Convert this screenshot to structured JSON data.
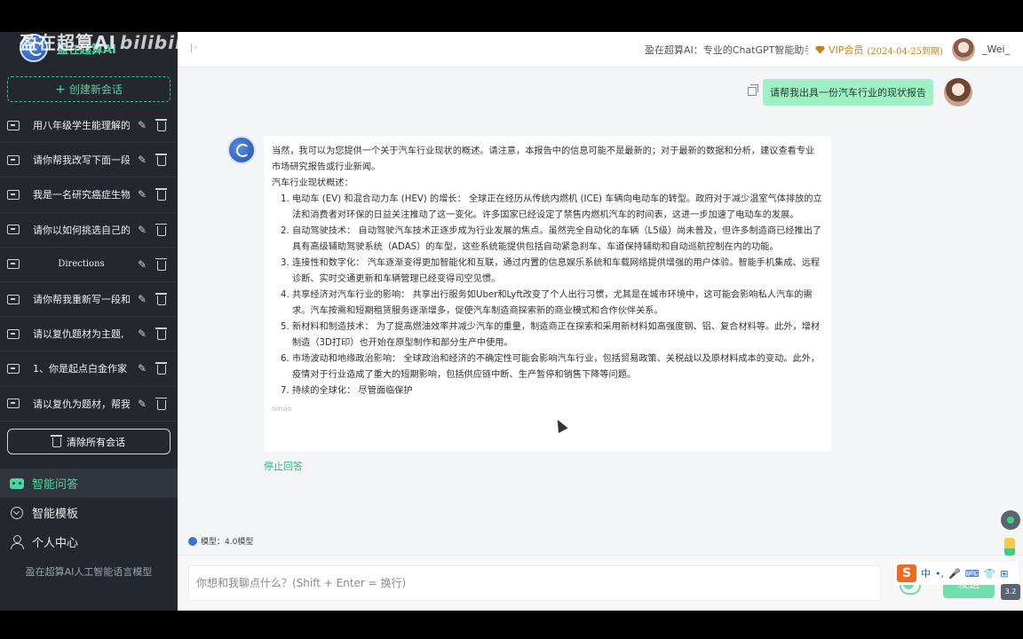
{
  "sidebar": {
    "brand": "盈在超算AI",
    "new_chat_label": "创建新会话",
    "conversations": [
      {
        "label": "用八年级学生能理解的"
      },
      {
        "label": "请你帮我改写下面一段"
      },
      {
        "label": "我是一名研究癌症生物"
      },
      {
        "label": "请你以如何挑选自己的"
      },
      {
        "label": "Directions"
      },
      {
        "label": "请你帮我重新写一段和"
      },
      {
        "label": "请以复仇题材为主题,"
      },
      {
        "label": "1、你是起点白金作家"
      },
      {
        "label": "请以复仇为题材，帮我"
      }
    ],
    "clear_all_label": "清除所有会话",
    "menu": [
      {
        "label": "智能问答",
        "icon": "robot-icon"
      },
      {
        "label": "智能模板",
        "icon": "template-icon"
      },
      {
        "label": "个人中心",
        "icon": "user-icon"
      }
    ],
    "footer": "盈在超算AI人工智能语言模型"
  },
  "header": {
    "collapse": "|◦",
    "title": "盈在超算AI：专业的ChatGPT智能助手",
    "vip_label": "VIP会员",
    "vip_expiry": "(2024-04-25到期)",
    "username": "_Wei_"
  },
  "chat": {
    "user_message": "请帮我出具一份汽车行业的现状报告",
    "bot_intro": "当然，我可以为您提供一个关于汽车行业现状的概述。请注意，本报告中的信息可能不是最新的；对于最新的数据和分析，建议查看专业市场研究报告或行业新闻。",
    "bot_heading": "汽车行业现状概述：",
    "bot_points": [
      {
        "num": "1.",
        "text": "电动车 (EV) 和混合动力车 (HEV) 的增长： 全球正在经历从传统内燃机 (ICE) 车辆向电动车的转型。政府对于减少温室气体排放的立法和消费者对环保的日益关注推动了这一变化。许多国家已经设定了禁售内燃机汽车的时间表，这进一步加速了电动车的发展。"
      },
      {
        "num": "2.",
        "text": "自动驾驶技术： 自动驾驶汽车技术正逐步成为行业发展的焦点。虽然完全自动化的车辆（L5级）尚未普及，但许多制造商已经推出了具有高级辅助驾驶系统（ADAS）的车型，这些系统能提供包括自动紧急刹车、车道保持辅助和自动巡航控制在内的功能。"
      },
      {
        "num": "3.",
        "text": "连接性和数字化： 汽车逐渐变得更加智能化和互联，通过内置的信息娱乐系统和车载网络提供增强的用户体验。智能手机集成、远程诊断、实时交通更新和车辆管理已经变得司空见惯。"
      },
      {
        "num": "4.",
        "text": "共享经济对汽车行业的影响： 共享出行服务如Uber和Lyft改变了个人出行习惯，尤其是在城市环境中，这可能会影响私人汽车的需求。汽车按需和短期租赁服务逐渐增多，促使汽车制造商探索新的商业模式和合作伙伴关系。"
      },
      {
        "num": "5.",
        "text": "新材料和制造技术： 为了提高燃油效率并减少汽车的重量，制造商正在探索和采用新材料如高强度钢、铝、复合材料等。此外，增材制造（3D打印）也开始在原型制作和部分生产中使用。"
      },
      {
        "num": "6.",
        "text": "市场波动和地缘政治影响： 全球政治和经济的不确定性可能会影响汽车行业，包括贸易政策、关税战以及原材料成本的变动。此外，疫情对于行业造成了重大的短期影响，包括供应链中断、生产暂停和销售下降等问题。"
      },
      {
        "num": "7.",
        "text": "持续的全球化： 尽管面临保护"
      }
    ],
    "typing_indicator": "omoo",
    "stop_label": "停止回答"
  },
  "input": {
    "model_label": "模型：4.0模型",
    "placeholder": "你想和我聊点什么？(Shift + Enter = 换行)",
    "send_label": "发送"
  },
  "ime": {
    "logo": "S",
    "lang": "中",
    "punct": "•,",
    "mic": "🎤",
    "keyboard": "⌨",
    "shirt": "👕",
    "grid": "⊞"
  },
  "overlay": {
    "watermark_brand": "盈在超算AI",
    "watermark_bili": "bilibili",
    "badge_text": "3.2"
  },
  "colors": {
    "sidebar_bg": "#24272e",
    "accent": "#4fd6a0",
    "user_bubble": "#9ff0c5",
    "vip": "#c4821e"
  }
}
